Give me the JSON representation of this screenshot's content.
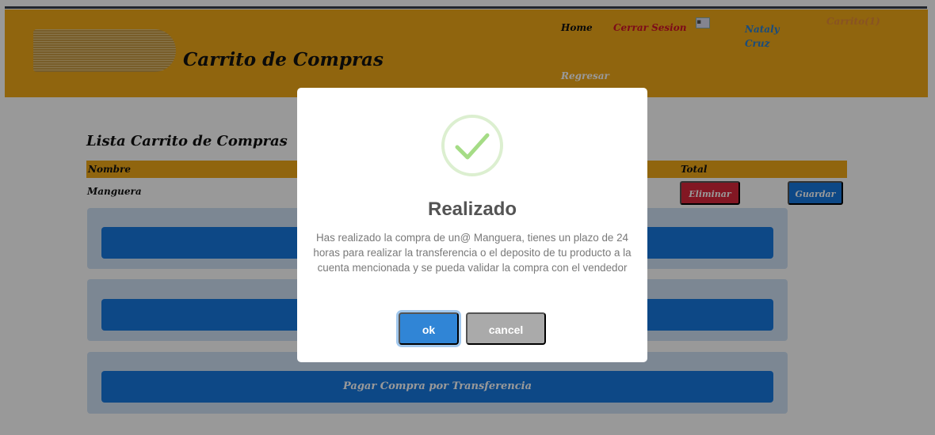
{
  "header": {
    "title": "Carrito de Compras",
    "nav_home": "Home",
    "nav_logout": "Cerrar Sesion",
    "nav_back": "Regresar",
    "user_first": "Nataly",
    "user_last": "Cruz",
    "cart": "Carrito(1)"
  },
  "main": {
    "list_title": "Lista Carrito de Compras",
    "columns": {
      "name": "Nombre",
      "total": "Total"
    },
    "row": {
      "name": "Manguera",
      "delete_label": "Eliminar",
      "save_label": "Guardar"
    },
    "pay_buttons": [
      "",
      "",
      "Pagar Compra por Transferencia"
    ]
  },
  "modal": {
    "icon": "check-icon",
    "title": "Realizado",
    "text": "Has realizado la compra de un@ Manguera, tienes un plazo de 24 horas para realizar la transferencia o el deposito de tu producto a la cuenta mencionada y se pueda validar la compra con el vendedor",
    "ok_label": "ok",
    "cancel_label": "cancel"
  },
  "colors": {
    "header_bg": "#f0a818",
    "primary": "#1778e0",
    "danger": "#d9273b",
    "success": "#a5dc86",
    "modal_confirm": "#3085d6",
    "modal_cancel": "#aaaaaa"
  }
}
